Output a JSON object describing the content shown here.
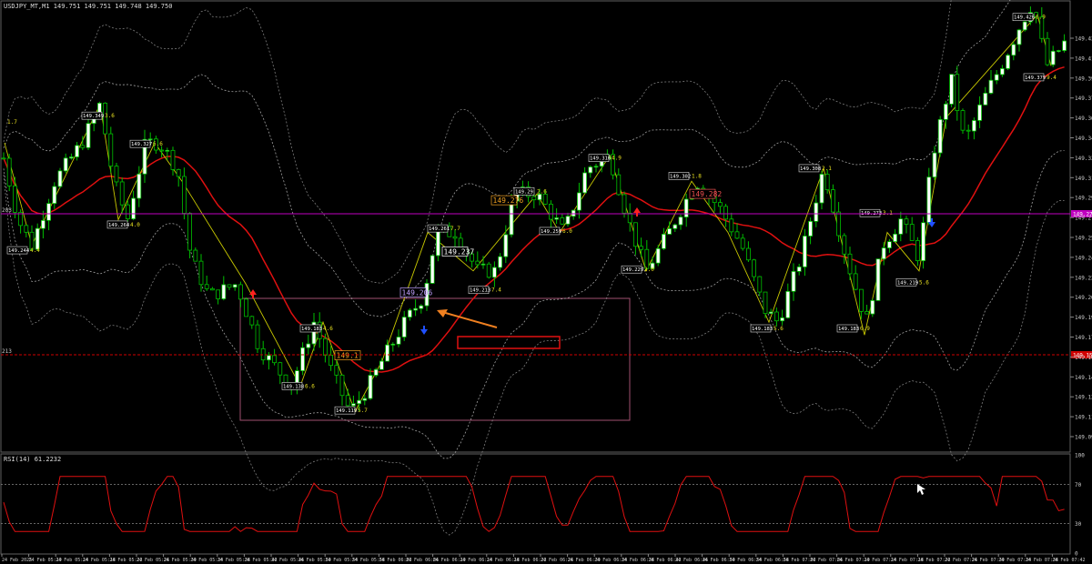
{
  "header": {
    "symbol_line": "USDJPY_MT,M1  149.751 149.751 149.748 149.750"
  },
  "rsi_panel": {
    "label": "RSI(14) 61.2232",
    "levels": [
      "100",
      "70",
      "30",
      "0"
    ]
  },
  "price_axis": {
    "ticks": [
      "149.430",
      "149.410",
      "149.390",
      "149.375",
      "149.360",
      "149.345",
      "149.330",
      "149.310",
      "149.295",
      "149.270",
      "149.255",
      "149.240",
      "149.225",
      "149.205",
      "149.190",
      "149.175",
      "149.160",
      "149.145",
      "149.125",
      "149.110",
      "149.095"
    ],
    "ticks_label_min": 149.095,
    "ticks_label_max": 149.43,
    "current_price": "149.275",
    "level_line": "149.158",
    "left_marker_upper": "203",
    "left_marker_lower": "213"
  },
  "time_axis": {
    "labels": [
      "24 Feb 2025",
      "24 Feb 05:10",
      "24 Feb 05:14",
      "24 Feb 05:18",
      "24 Feb 05:22",
      "24 Feb 05:26",
      "24 Feb 05:30",
      "24 Feb 05:34",
      "24 Feb 05:38",
      "24 Feb 05:42",
      "24 Feb 05:46",
      "24 Feb 05:50",
      "24 Feb 05:54",
      "24 Feb 05:58",
      "24 Feb 06:02",
      "24 Feb 06:06",
      "24 Feb 06:10",
      "24 Feb 06:14",
      "24 Feb 06:18",
      "24 Feb 06:22",
      "24 Feb 06:26",
      "24 Feb 06:30",
      "24 Feb 06:34",
      "24 Feb 06:38",
      "24 Feb 06:42",
      "24 Feb 06:46",
      "24 Feb 06:50",
      "24 Feb 06:54",
      "24 Feb 06:58",
      "24 Feb 07:02",
      "24 Feb 07:06",
      "24 Feb 07:10",
      "24 Feb 07:14",
      "24 Feb 07:18",
      "24 Feb 07:22",
      "24 Feb 07:26",
      "24 Feb 07:30",
      "24 Feb 07:34",
      "24 Feb 07:38",
      "24 Feb 07:42"
    ]
  },
  "chart_data": {
    "type": "candlestick",
    "price_range": [
      149.09,
      149.44
    ],
    "colors": {
      "bull": "#ffffff",
      "bear": "#000000",
      "wick": "#00c000",
      "ma": "#e01010",
      "bands": "#b0b0b0",
      "zigzag": "#c8c800",
      "rsi": "#e01010",
      "current_line": "#c000c0",
      "level_line": "#d00000",
      "highlight_box": "#a05070",
      "annotation_box": "#e01010",
      "arrow": "#f08020"
    },
    "swing_labels": [
      {
        "price": "149.349",
        "tag": "3.6"
      },
      {
        "price": "149.327",
        "tag": "6.6"
      },
      {
        "price": "149.244",
        "tag": "4.4"
      },
      {
        "price": "149.264",
        "tag": "4.0"
      },
      {
        "price": "149.183",
        "tag": "4.6"
      },
      {
        "price": "149.138",
        "tag": "6.6"
      },
      {
        "price": "149.119",
        "tag": "5.7"
      },
      {
        "price": "149.261",
        "tag": "7.7"
      },
      {
        "price": "149.213",
        "tag": "7.4"
      },
      {
        "price": "149.29",
        "tag": "2.6"
      },
      {
        "price": "149.259",
        "tag": "6.0"
      },
      {
        "price": "149.316",
        "tag": "4.9"
      },
      {
        "price": "149.229",
        "tag": "2.0"
      },
      {
        "price": "149.302",
        "tag": "1.8"
      },
      {
        "price": "149.183",
        "tag": "5.6"
      },
      {
        "price": "149.308",
        "tag": "2.1"
      },
      {
        "price": "149.183",
        "tag": "0.9"
      },
      {
        "price": "149.273",
        "tag": "3.1"
      },
      {
        "price": "149.219",
        "tag": "5.6"
      },
      {
        "price": "149.426",
        "tag": "6.9"
      },
      {
        "price": "149.379",
        "tag": "9.4"
      }
    ],
    "top_left_tag": "1.7",
    "callouts": [
      "149.237",
      "149.276",
      "149.206",
      "149.282",
      "149.1"
    ],
    "annotation_text": "",
    "rsi_levels": [
      70,
      30
    ]
  }
}
